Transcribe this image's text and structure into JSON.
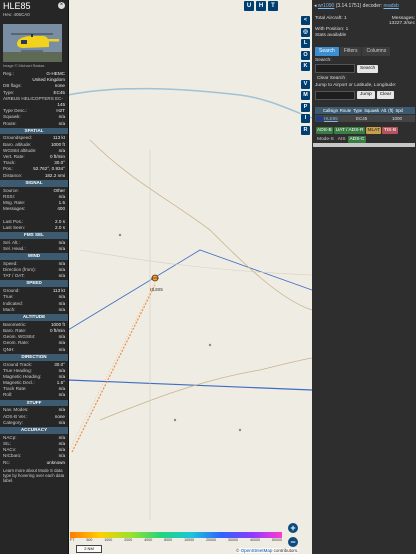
{
  "aircraft": {
    "callsign": "HLE85",
    "hex": "Hex: 406CA0",
    "image_credit": "Image © Michael Rastas",
    "info_rows": [
      {
        "k": "Reg.:",
        "v": "G-HEMC"
      },
      {
        "k": "",
        "v": "United Kingdom"
      },
      {
        "k": "DB flags:",
        "v": "none"
      },
      {
        "k": "Type:",
        "v": "EC45"
      },
      {
        "k": "AIRBUS HELICOPTERS EC-",
        "v": ""
      },
      {
        "k": "",
        "v": "145"
      },
      {
        "k": "Type Desc.:",
        "v": "H2T"
      },
      {
        "k": "Squawk:",
        "v": "n/a"
      },
      {
        "k": "Route:",
        "v": "n/a"
      }
    ]
  },
  "sections": [
    {
      "title": "SPATIAL",
      "rows": [
        {
          "k": "Groundspeed:",
          "v": "113 kt"
        },
        {
          "k": "Baro. altitude:",
          "v": "1000 ft"
        },
        {
          "k": "WGS84 altitude:",
          "v": "n/a"
        },
        {
          "k": "Vert. Rate:",
          "v": "0 ft/min"
        },
        {
          "k": "Track:",
          "v": "30.0°"
        },
        {
          "k": "Pos.:",
          "v": "52.762°, 0.934°"
        },
        {
          "k": "Distance:",
          "v": "182.2 nmi"
        }
      ]
    },
    {
      "title": "SIGNAL",
      "rows": [
        {
          "k": "Source:",
          "v": "Other"
        },
        {
          "k": "RSSI:",
          "v": "n/a"
        },
        {
          "k": "Msg. Rate:",
          "v": "1.5"
        },
        {
          "k": "Messages:",
          "v": "400"
        },
        {
          "k": "",
          "v": ""
        },
        {
          "k": "Last Pos.:",
          "v": "2.0 s"
        },
        {
          "k": "Last Seen:",
          "v": "2.0 s"
        }
      ]
    },
    {
      "title": "FMS SEL",
      "rows": [
        {
          "k": "Sel. Alt.:",
          "v": "n/a"
        },
        {
          "k": "Sel. Head.:",
          "v": "n/a"
        }
      ]
    },
    {
      "title": "WIND",
      "rows": [
        {
          "k": "Speed:",
          "v": "n/a"
        },
        {
          "k": "Direction (from):",
          "v": "n/a"
        },
        {
          "k": "TAT / OAT:",
          "v": "n/a"
        }
      ]
    },
    {
      "title": "SPEED",
      "rows": [
        {
          "k": "Ground:",
          "v": "113 kt"
        },
        {
          "k": "True:",
          "v": "n/a"
        },
        {
          "k": "Indicated:",
          "v": "n/a"
        },
        {
          "k": "Mach:",
          "v": "n/a"
        }
      ]
    },
    {
      "title": "ALTITUDE",
      "rows": [
        {
          "k": "Barometric:",
          "v": "1000 ft"
        },
        {
          "k": "Baro. Rate:",
          "v": "0 ft/min"
        },
        {
          "k": "Geom. WGS84:",
          "v": "n/a"
        },
        {
          "k": "Geom. Rate:",
          "v": "n/a"
        },
        {
          "k": "QNH:",
          "v": "n/a"
        }
      ]
    },
    {
      "title": "DIRECTION",
      "rows": [
        {
          "k": "Ground Track:",
          "v": "30.0°"
        },
        {
          "k": "True Heading:",
          "v": "n/a"
        },
        {
          "k": "Magnetic Heading:",
          "v": "n/a"
        },
        {
          "k": "Magnetic Decl.:",
          "v": "1.5°"
        },
        {
          "k": "Track Rate:",
          "v": "n/a"
        },
        {
          "k": "Roll:",
          "v": "n/a"
        }
      ]
    },
    {
      "title": "STUFF",
      "rows": [
        {
          "k": "Nav. Modes:",
          "v": "n/a"
        },
        {
          "k": "ADS-B Ver.:",
          "v": "none"
        },
        {
          "k": "Category:",
          "v": "n/a"
        }
      ]
    },
    {
      "title": "ACCURACY",
      "rows": [
        {
          "k": "NACp:",
          "v": "n/a"
        },
        {
          "k": "SIL:",
          "v": "n/a"
        },
        {
          "k": "NACv:",
          "v": "n/a"
        },
        {
          "k": "NICbaro:",
          "v": "n/a"
        },
        {
          "k": "Rc:",
          "v": "unknown"
        }
      ]
    }
  ],
  "learn_more": "Learn more about Mode S data type by hovering over each data label.",
  "top_buttons": [
    "U",
    "H",
    "T"
  ],
  "side_buttons": [
    "<",
    "◎",
    "L",
    "O",
    "K",
    "",
    "V",
    "M",
    "P",
    "I",
    "R"
  ],
  "right_panel": {
    "header_prefix": "◂ ",
    "header_link": "wr1090",
    "header_rest": " (3.14.1751) decoder: ",
    "header_mode": "readsb",
    "total_aircraft": "Total Aircraft: 1",
    "messages_label": "Messages:",
    "messages_value": "13227.3/sec",
    "with_position": "With Position: 1",
    "stats": "Stats available",
    "tabs": [
      "Search",
      "Filters",
      "Columns"
    ],
    "search_label": "Search:",
    "search_button": "Search",
    "clear_search": "Clear Search",
    "jump_label": "Jump to Airport or Latitude, Longitude:",
    "jump_button": "Jump",
    "clear_button": "Clear",
    "table_headers": [
      "Callsign",
      "Route",
      "Type",
      "Squawk",
      "Alt. (ft)",
      "Spd"
    ],
    "row": {
      "callsign": "HLE85",
      "type": "EC45",
      "alt": "1000"
    },
    "chips": [
      "ADS-B",
      "UAT / ADS-R",
      "MLAT",
      "TIS-B",
      "Mode-S",
      "AIS",
      "ADS-C"
    ]
  },
  "map": {
    "alt_labels": [
      "FT",
      "500",
      "1000",
      "2000",
      "4000",
      "8000",
      "10000",
      "20000",
      "30000",
      "40000",
      "50000"
    ],
    "scale": "2 NM",
    "attribution_prefix": "© ",
    "attribution_link": "OpenStreetMap",
    "attribution_suffix": " contributors."
  }
}
